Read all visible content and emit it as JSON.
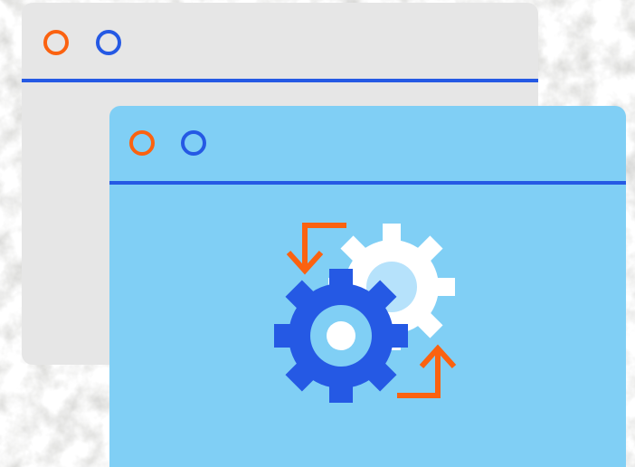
{
  "colors": {
    "background_paper": "#c9c9c6",
    "back_window_fill": "#e6e6e6",
    "front_window_fill": "#80cff5",
    "rule_blue": "#2559e4",
    "dot_orange": "#fb6210",
    "dot_blue": "#2559e4",
    "gear_dark_blue": "#2559e4",
    "gear_white": "#ffffff",
    "gear_light_blue": "#b6e2fb",
    "arrow_orange": "#fb6210"
  },
  "back_window": {
    "controls": [
      "orange-circle",
      "blue-circle"
    ]
  },
  "front_window": {
    "controls": [
      "orange-circle",
      "blue-circle"
    ],
    "illustration": {
      "icons": [
        "large-gear-icon",
        "small-gear-icon",
        "arrow-down-icon",
        "arrow-up-icon"
      ]
    }
  }
}
